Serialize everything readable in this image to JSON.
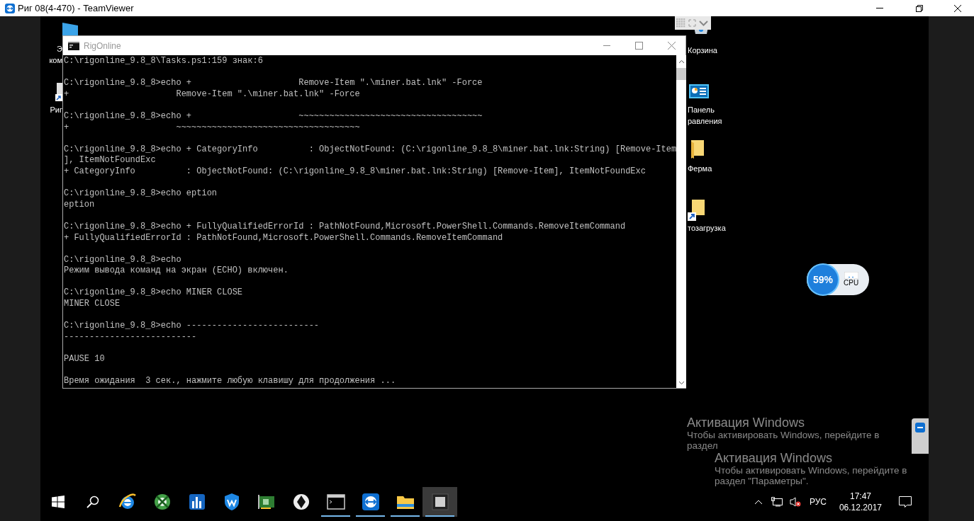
{
  "window": {
    "title": "Риг 08(4-470) - TeamViewer"
  },
  "desktop_icons": [
    {
      "kind": "pc",
      "label_lines": [
        "Э",
        "ком"
      ]
    },
    {
      "kind": "shortcut",
      "label_lines": [
        "Риг"
      ]
    },
    {
      "kind": "recycle",
      "label_lines": [
        "Корзина"
      ]
    },
    {
      "kind": "control_panel",
      "label_lines": [
        "Панель",
        "равления"
      ]
    },
    {
      "kind": "folder",
      "label_lines": [
        "Ферма"
      ]
    },
    {
      "kind": "folder_shortcut",
      "label_lines": [
        "тозагрузка"
      ]
    }
  ],
  "console": {
    "title": "RigOnline",
    "blocks": [
      [
        "C:\\rigonline_9.8_8\\Tasks.ps1:159 знак:6"
      ],
      [
        "C:\\rigonline_9.8_8>echo +                     Remove-Item \".\\miner.bat.lnk\" -Force",
        "+                     Remove-Item \".\\miner.bat.lnk\" -Force"
      ],
      [
        "C:\\rigonline_9.8_8>echo +                     ~~~~~~~~~~~~~~~~~~~~~~~~~~~~~~~~~~~~",
        "+                     ~~~~~~~~~~~~~~~~~~~~~~~~~~~~~~~~~~~~"
      ],
      [
        "C:\\rigonline_9.8_8>echo + CategoryInfo          : ObjectNotFound: (C:\\rigonline_9.8_8\\miner.bat.lnk:String) [Remove-Item",
        "], ItemNotFoundExc",
        "+ CategoryInfo          : ObjectNotFound: (C:\\rigonline_9.8_8\\miner.bat.lnk:String) [Remove-Item], ItemNotFoundExc"
      ],
      [
        "C:\\rigonline_9.8_8>echo eption",
        "eption"
      ],
      [
        "C:\\rigonline_9.8_8>echo + FullyQualifiedErrorId : PathNotFound,Microsoft.PowerShell.Commands.RemoveItemCommand",
        "+ FullyQualifiedErrorId : PathNotFound,Microsoft.PowerShell.Commands.RemoveItemCommand"
      ],
      [
        "C:\\rigonline_9.8_8>echo",
        "Режим вывода команд на экран (ECHO) включен."
      ],
      [
        "C:\\rigonline_9.8_8>echo MINER CLOSE",
        "MINER CLOSE"
      ],
      [
        "C:\\rigonline_9.8_8>echo --------------------------",
        "--------------------------"
      ],
      [
        "PAUSE 10"
      ],
      [
        "Время ожидания  3 сек., нажмите любую клавишу для продолжения ..."
      ]
    ]
  },
  "cpu_widget": {
    "value": "59%",
    "label": "CPU"
  },
  "activation_notices": [
    {
      "title": "Активация Windows",
      "lines": [
        "Чтобы активировать Windows, перейдите в",
        "раздел"
      ]
    },
    {
      "title": "Активация Windows",
      "lines": [
        "Чтобы активировать Windows, перейдите в",
        "раздел \"Параметры\"."
      ]
    }
  ],
  "taskbar": {
    "items": [
      {
        "kind": "start",
        "running": false,
        "selected": false
      },
      {
        "kind": "search",
        "running": false,
        "selected": false
      },
      {
        "kind": "browser",
        "running": false,
        "selected": false
      },
      {
        "kind": "game",
        "running": false,
        "selected": false
      },
      {
        "kind": "bars",
        "running": false,
        "selected": false
      },
      {
        "kind": "shield",
        "running": false,
        "selected": false
      },
      {
        "kind": "card",
        "running": false,
        "selected": false
      },
      {
        "kind": "circle",
        "running": false,
        "selected": false
      },
      {
        "kind": "terminal",
        "running": true,
        "selected": false
      },
      {
        "kind": "remote",
        "running": true,
        "selected": false
      },
      {
        "kind": "folder",
        "running": true,
        "selected": false
      },
      {
        "kind": "chip",
        "running": true,
        "selected": true
      }
    ],
    "tray": {
      "language": "РУС",
      "time": "17:47",
      "date": "06.12.2017"
    }
  }
}
